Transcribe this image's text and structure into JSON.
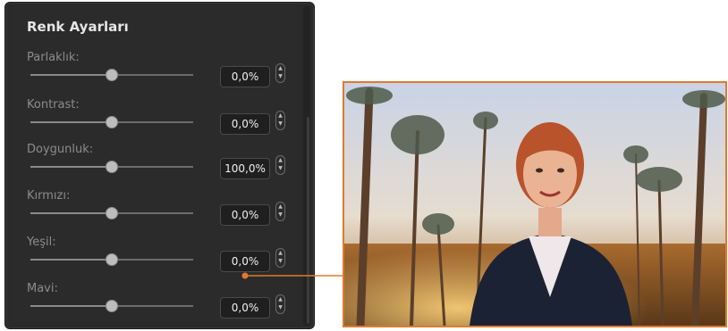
{
  "panel": {
    "title": "Renk Ayarları",
    "rows": [
      {
        "label": "Parlaklık:",
        "value": "0,0%",
        "level": 0.5
      },
      {
        "label": "Kontrast:",
        "value": "0,0%",
        "level": 0.5
      },
      {
        "label": "Doygunluk:",
        "value": "100,0%",
        "level": 0.5
      },
      {
        "label": "Kırmızı:",
        "value": "0,0%",
        "level": 0.5
      },
      {
        "label": "Yeşil:",
        "value": "0,0%",
        "level": 0.5
      },
      {
        "label": "Mavi:",
        "value": "0,0%",
        "level": 0.5
      }
    ],
    "stepper_icon": "up-down-arrows-icon"
  },
  "colors": {
    "accent": "#e07a2e",
    "panel_bg": "#2b2b2b"
  },
  "preview": {
    "icon": "video-preview-image"
  }
}
